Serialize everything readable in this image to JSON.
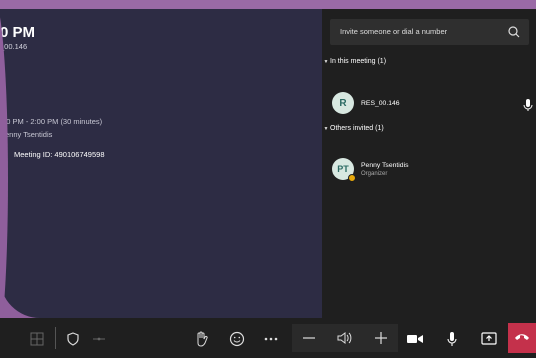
{
  "meeting": {
    "time_title": "0 PM",
    "subtitle": "_00.146",
    "schedule": ":30 PM - 2:00 PM (30 minutes)",
    "organizer_line": "Penny Tsentidis",
    "meeting_id_label": "Meeting ID: 490106749598"
  },
  "sidebar": {
    "invite_placeholder": "Invite someone or dial a number",
    "in_meeting_label": "In this meeting (1)",
    "others_invited_label": "Others invited (1)",
    "participants": [
      {
        "initials": "R",
        "name": "RES_00.146",
        "role": ""
      },
      {
        "initials": "PT",
        "name": "Penny Tsentidis",
        "role": "Organizer"
      }
    ]
  },
  "toolbar": {
    "icons": [
      "grid-icon",
      "shield-icon",
      "dialpad-icon",
      "raise-hand-icon",
      "emoji-icon",
      "more-icon",
      "volume-down-icon",
      "speaker-icon",
      "volume-up-icon",
      "camera-icon",
      "microphone-icon",
      "share-icon",
      "hangup-icon"
    ]
  },
  "colors": {
    "accent": "#c4314b",
    "background": "#2d2c44",
    "sidebar": "#1f1f1f",
    "avatar_badge": "#e6a80b"
  }
}
